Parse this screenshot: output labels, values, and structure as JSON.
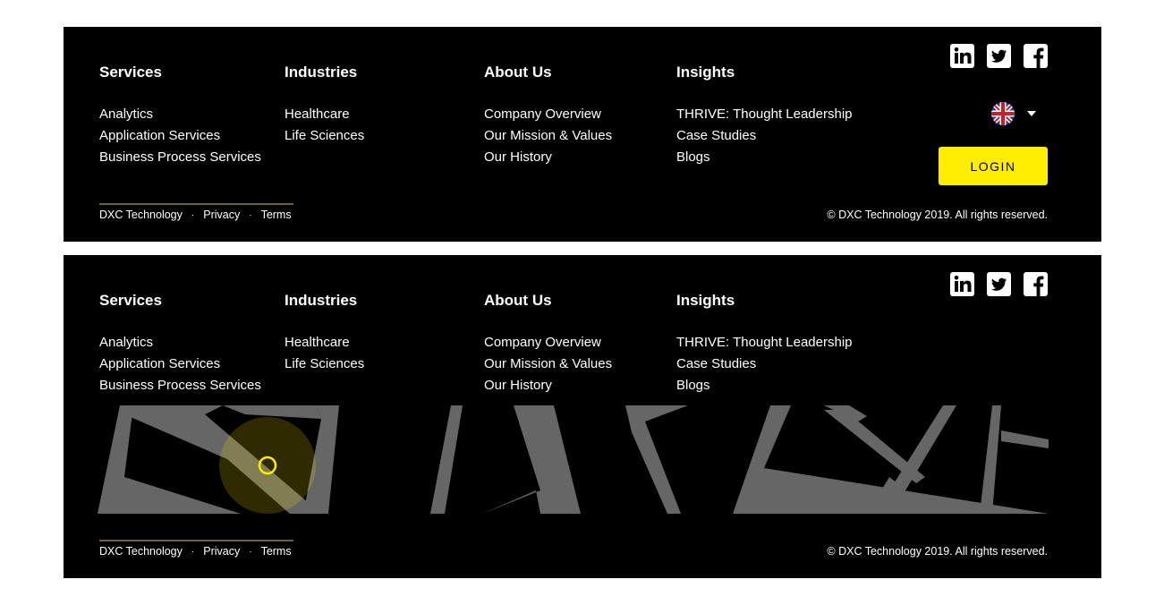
{
  "columns": [
    {
      "heading": "Services",
      "links": [
        "Analytics",
        "Application Services",
        "Business Process Services"
      ]
    },
    {
      "heading": "Industries",
      "links": [
        "Healthcare",
        "Life Sciences"
      ]
    },
    {
      "heading": "About Us",
      "links": [
        "Company Overview",
        "Our Mission & Values",
        "Our History"
      ]
    },
    {
      "heading": "Insights",
      "links": [
        "THRIVE: Thought Leadership",
        "Case Studies",
        "Blogs"
      ]
    }
  ],
  "social": [
    "linkedin-icon",
    "twitter-icon",
    "facebook-icon"
  ],
  "language": {
    "flag": "uk-flag-icon",
    "dropdown": "chevron-down-icon"
  },
  "login_label": "LOGIN",
  "legal": {
    "company": "DXC Technology",
    "privacy": "Privacy",
    "terms": "Terms",
    "separator": "·"
  },
  "copyright": "© DXC Technology 2019. All rights reserved.",
  "colors": {
    "background": "#000000",
    "accent": "#ffed00",
    "map_roads": "#666666"
  }
}
